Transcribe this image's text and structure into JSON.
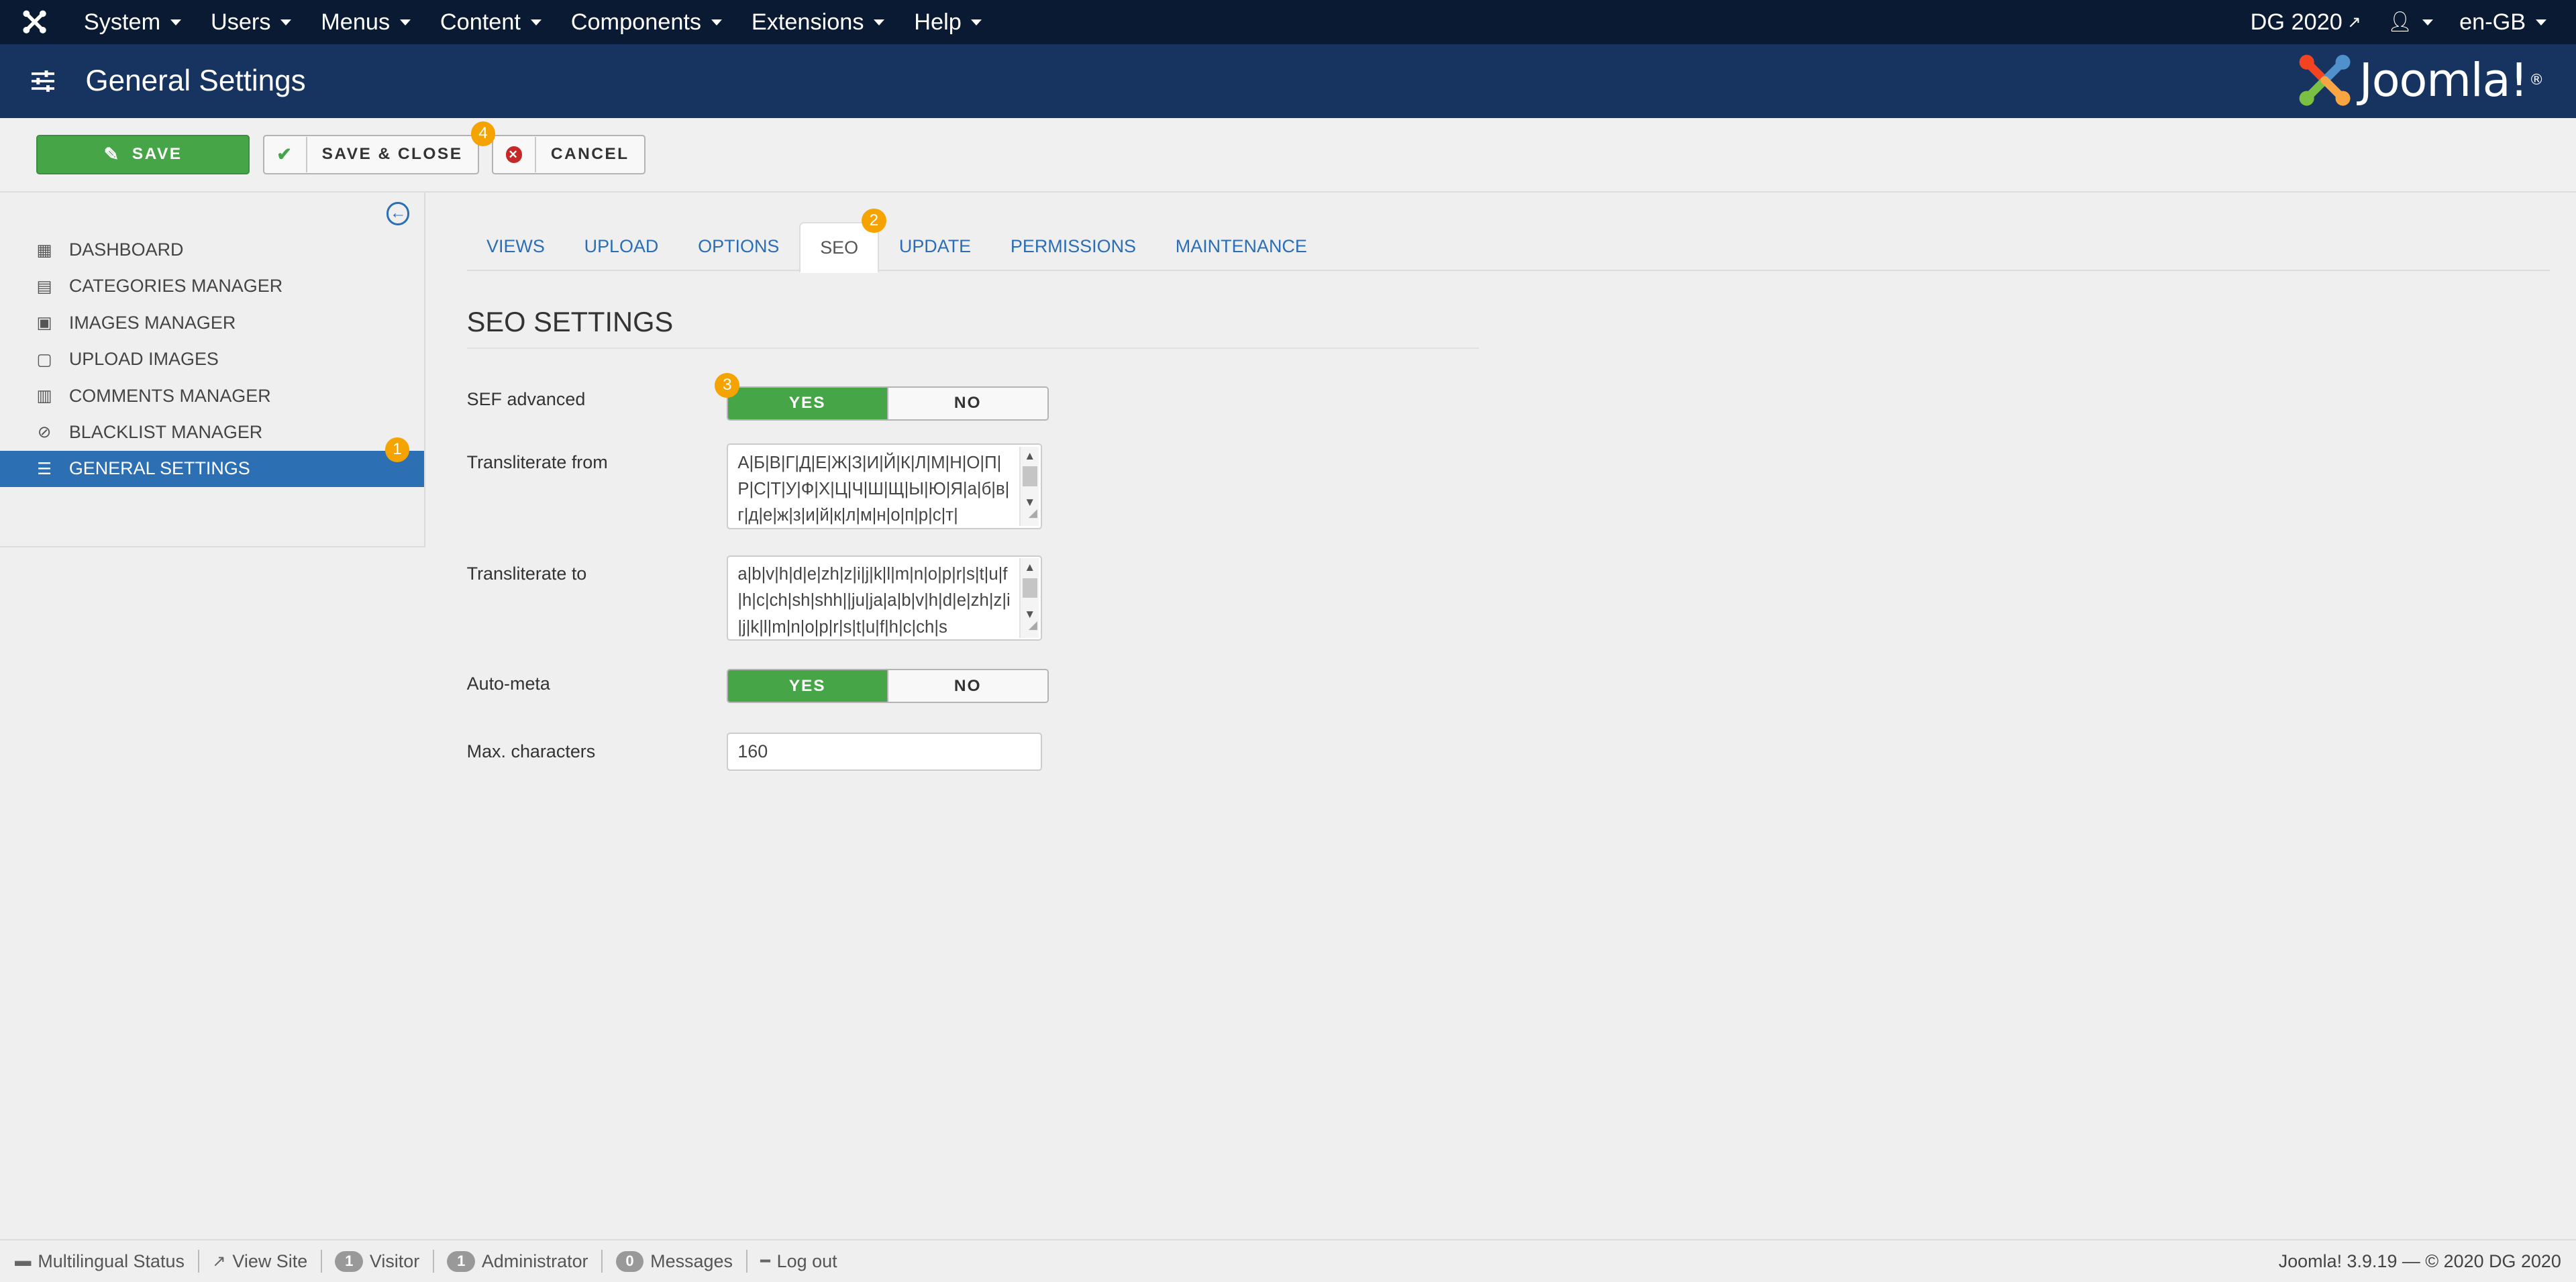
{
  "navbar": {
    "menu": [
      {
        "label": "System"
      },
      {
        "label": "Users"
      },
      {
        "label": "Menus"
      },
      {
        "label": "Content"
      },
      {
        "label": "Components"
      },
      {
        "label": "Extensions"
      },
      {
        "label": "Help"
      }
    ],
    "site_name": "DG 2020",
    "language": "en-GB"
  },
  "header": {
    "title": "General Settings",
    "brand": "Joomla!",
    "brand_mark": "®"
  },
  "toolbar": {
    "save_label": "SAVE",
    "save_close_label": "SAVE & CLOSE",
    "cancel_label": "CANCEL",
    "save_close_badge": "4"
  },
  "sidebar": {
    "items": [
      {
        "label": "DASHBOARD",
        "icon": "dashboard-icon"
      },
      {
        "label": "CATEGORIES MANAGER",
        "icon": "categories-icon"
      },
      {
        "label": "IMAGES MANAGER",
        "icon": "image-icon"
      },
      {
        "label": "UPLOAD IMAGES",
        "icon": "upload-icon"
      },
      {
        "label": "COMMENTS MANAGER",
        "icon": "comments-icon"
      },
      {
        "label": "BLACKLIST MANAGER",
        "icon": "blacklist-icon"
      },
      {
        "label": "GENERAL SETTINGS",
        "icon": "sliders-icon",
        "active": true
      }
    ],
    "active_badge": "1"
  },
  "tabs": {
    "items": [
      "VIEWS",
      "UPLOAD",
      "OPTIONS",
      "SEO",
      "UPDATE",
      "PERMISSIONS",
      "MAINTENANCE"
    ],
    "active": "SEO",
    "seo_badge": "2"
  },
  "seo": {
    "section_title": "SEO SETTINGS",
    "sef_label": "SEF advanced",
    "sef_badge": "3",
    "sef_yes": "YES",
    "sef_no": "NO",
    "sef_value": "YES",
    "translit_from_label": "Transliterate from",
    "translit_from_value": "А|Б|В|Г|Д|Е|Ж|З|И|Й|К|Л|М|Н|О|П|Р|С|Т|У|Ф|Х|Ц|Ч|Ш|Щ|Ы|Ю|Я|а|б|в|г|д|е|ж|з|и|й|к|л|м|н|о|п|р|с|т|",
    "translit_to_label": "Transliterate to",
    "translit_to_value": "a|b|v|h|d|e|zh|z|i|j|k|l|m|n|o|p|r|s|t|u|f|h|c|ch|sh|shh||ju|ja|a|b|v|h|d|e|zh|z|i|j|k|l|m|n|o|p|r|s|t|u|f|h|c|ch|s",
    "autometa_label": "Auto-meta",
    "autometa_yes": "YES",
    "autometa_no": "NO",
    "autometa_value": "YES",
    "maxchars_label": "Max. characters",
    "maxchars_value": "160"
  },
  "footer": {
    "multilingual": "Multilingual Status",
    "view_site": "View Site",
    "visitor_count": "1",
    "visitor_label": "Visitor",
    "admin_count": "1",
    "admin_label": "Administrator",
    "messages_count": "0",
    "messages_label": "Messages",
    "logout": "Log out",
    "version": "Joomla! 3.9.19  —  © 2020 DG 2020"
  },
  "colors": {
    "navbar": "#0b1a33",
    "header": "#17335f",
    "success": "#46a546",
    "active": "#2d6fb3",
    "badge": "#f5a300",
    "link": "#2a6eb5"
  }
}
